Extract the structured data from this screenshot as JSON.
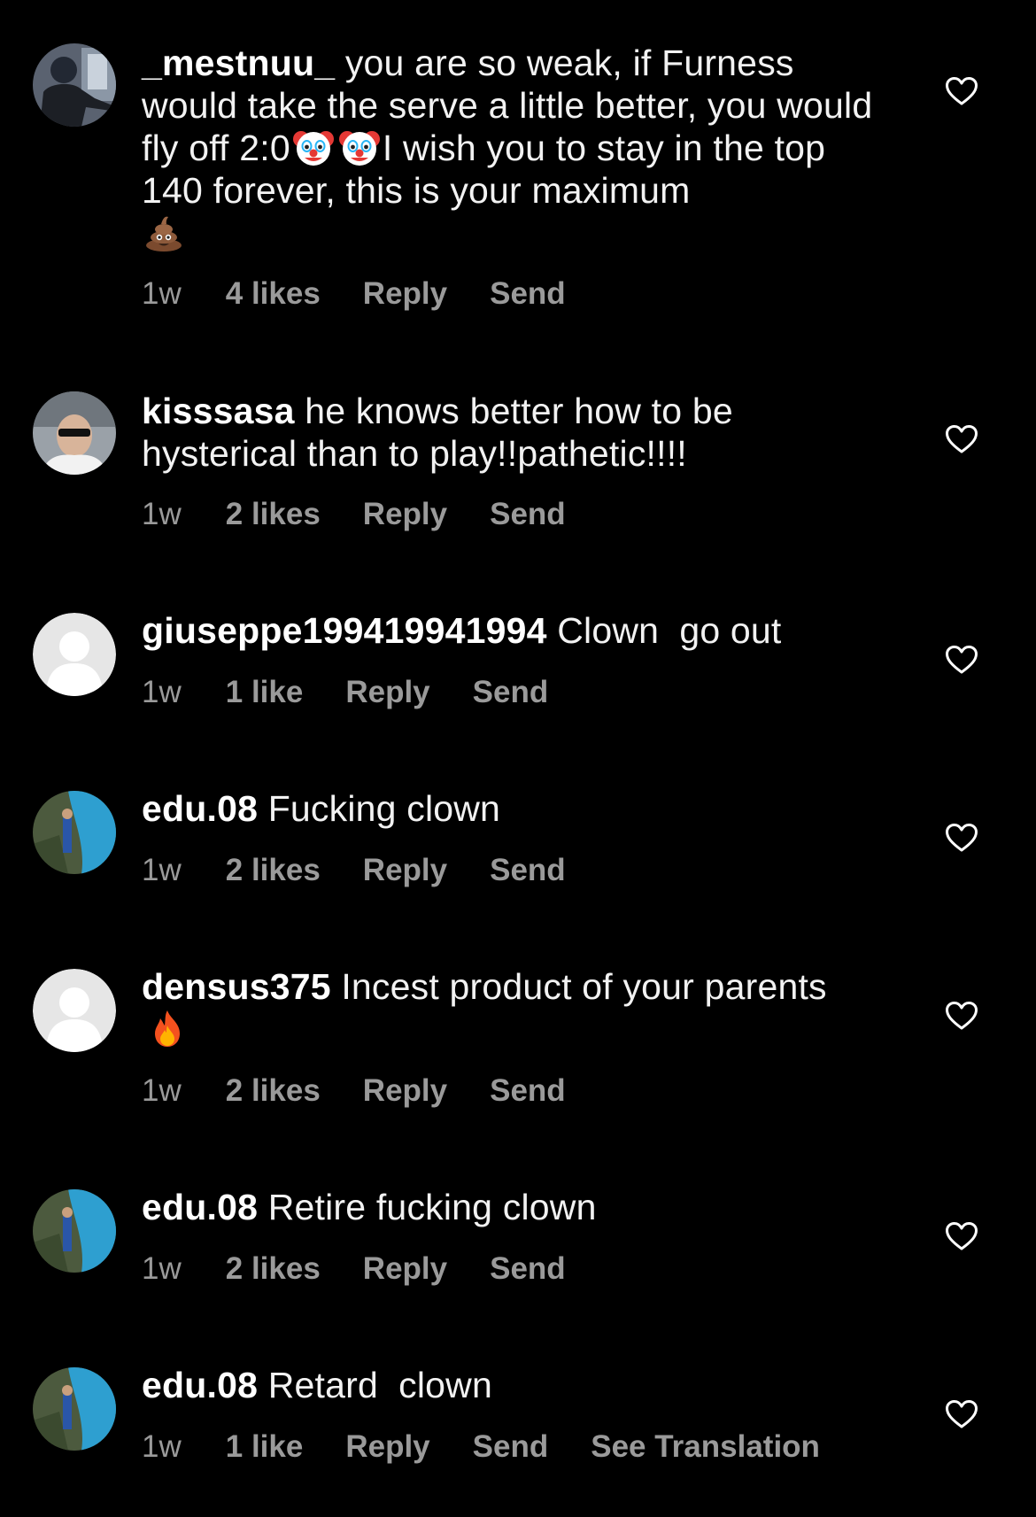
{
  "comments": [
    {
      "username": "_mestnuu_",
      "text_parts": [
        "you are so weak, if Furness would take the serve a little better, you would fly off 2:0",
        "I wish you to stay in the top 140 forever, this is your maximum"
      ],
      "emojis": [
        "clown-emoji",
        "clown-emoji",
        "poop-emoji"
      ],
      "time": "1w",
      "likes": "4 likes",
      "reply": "Reply",
      "send": "Send",
      "avatar": "photo"
    },
    {
      "username": "kisssasa",
      "text": "he knows better how to be hysterical than to play!!pathetic!!!!",
      "time": "1w",
      "likes": "2 likes",
      "reply": "Reply",
      "send": "Send",
      "avatar": "photo"
    },
    {
      "username": "giuseppe199419941994",
      "text": "Clown  go out",
      "time": "1w",
      "likes": "1 like",
      "reply": "Reply",
      "send": "Send",
      "avatar": "default"
    },
    {
      "username": "edu.08",
      "text": "Fucking clown",
      "time": "1w",
      "likes": "2 likes",
      "reply": "Reply",
      "send": "Send",
      "avatar": "photo"
    },
    {
      "username": "densus375",
      "text": "Incest product of your parents",
      "emojis": [
        "fire-emoji"
      ],
      "time": "1w",
      "likes": "2 likes",
      "reply": "Reply",
      "send": "Send",
      "avatar": "default"
    },
    {
      "username": "edu.08",
      "text": "Retire fucking clown",
      "time": "1w",
      "likes": "2 likes",
      "reply": "Reply",
      "send": "Send",
      "avatar": "photo"
    },
    {
      "username": "edu.08",
      "text": "Retard  clown",
      "time": "1w",
      "likes": "1 like",
      "reply": "Reply",
      "send": "Send",
      "see_translation": "See Translation",
      "avatar": "photo"
    }
  ],
  "colors": {
    "background": "#000000",
    "text": "#ffffff",
    "meta": "#9a9a9a",
    "heart": "#ffffff"
  },
  "icons": {
    "like": "heart-outline-icon"
  }
}
